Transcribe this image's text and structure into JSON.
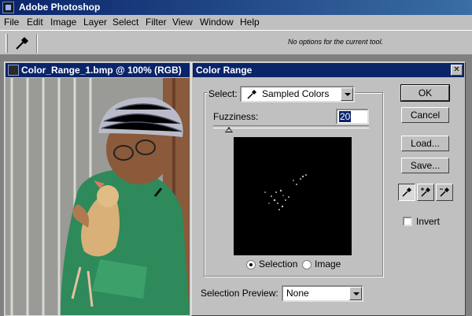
{
  "app": {
    "title": "Adobe Photoshop"
  },
  "menu": [
    {
      "label": "File"
    },
    {
      "label": "Edit"
    },
    {
      "label": "Image"
    },
    {
      "label": "Layer"
    },
    {
      "label": "Select"
    },
    {
      "label": "Filter"
    },
    {
      "label": "View"
    },
    {
      "label": "Window"
    },
    {
      "label": "Help"
    }
  ],
  "options_bar": {
    "tool_icon": "eyedropper-icon",
    "message": "No options for the current tool."
  },
  "document": {
    "title": "Color_Range_1.bmp @ 100% (RGB)"
  },
  "dialog": {
    "title": "Color Range",
    "select_label": "Select:",
    "select_value": "Sampled Colors",
    "fuzziness_label": "Fuzziness:",
    "fuzziness_value": "20",
    "fuzziness_level": 20,
    "radio_selection": "Selection",
    "radio_image": "Image",
    "radio_selected": "Selection",
    "preview_label": "Selection Preview:",
    "preview_value": "None",
    "buttons": {
      "ok": "OK",
      "cancel": "Cancel",
      "load": "Load...",
      "save": "Save..."
    },
    "eyedroppers": [
      "eyedropper-icon",
      "eyedropper-plus-icon",
      "eyedropper-minus-icon"
    ],
    "invert_label": "Invert",
    "invert_checked": false
  },
  "colors": {
    "titlebar": "#0a246a",
    "face": "#c0c0c0",
    "workspace": "#808080"
  }
}
